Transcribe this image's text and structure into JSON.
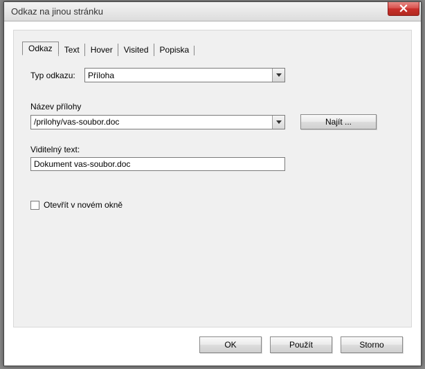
{
  "window": {
    "title": "Odkaz na jinou stránku"
  },
  "tabs": {
    "t0": "Odkaz",
    "t1": "Text",
    "t2": "Hover",
    "t3": "Visited",
    "t4": "Popiska"
  },
  "labels": {
    "type": "Typ odkazu:",
    "attachment_name": "Název přílohy",
    "visible_text": "Viditelný text:",
    "open_new_window": "Otevřít v novém okně"
  },
  "fields": {
    "type_value": "Příloha",
    "attachment_value": "/prilohy/vas-soubor.doc",
    "visible_value": "Dokument vas-soubor.doc"
  },
  "buttons": {
    "find": "Najít ...",
    "ok": "OK",
    "apply": "Použít",
    "cancel": "Storno"
  }
}
